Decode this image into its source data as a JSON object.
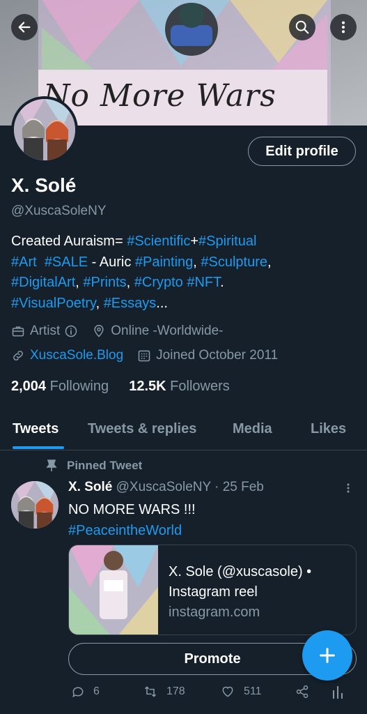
{
  "header": {
    "back_icon": "arrow-left-icon",
    "search_icon": "search-icon",
    "more_icon": "more-vertical-icon",
    "banner_text": "No More Wars"
  },
  "profile": {
    "edit_button": "Edit profile",
    "name": "X. Solé",
    "handle": "@XuscaSoleNY",
    "bio": {
      "p1": "Created Auraism= ",
      "t1": "#Scientific",
      "p2": "+",
      "t2": "#Spiritual",
      "t3": "#Art",
      "p3": "  ",
      "t4": "#SALE",
      "p4": " - Auric ",
      "t5": "#Painting",
      "p5": ", ",
      "t6": "#Sculpture",
      "p6": ",",
      "t7": "#DigitalArt",
      "p7": ", ",
      "t8": "#Prints",
      "p8": ", ",
      "t9": "#Crypto",
      "p9": " ",
      "t10": "#NFT",
      "p10": ".",
      "t11": "#VisualPoetry",
      "p11": ", ",
      "t12": "#Essays",
      "p12": "..."
    },
    "category": "Artist",
    "location": "Online -Worldwide-",
    "website": "XuscaSole.Blog",
    "joined": "Joined October 2011",
    "following_count": "2,004",
    "following_label": "Following",
    "followers_count": "12.5K",
    "followers_label": "Followers"
  },
  "tabs": [
    {
      "label": "Tweets"
    },
    {
      "label": "Tweets & replies"
    },
    {
      "label": "Media"
    },
    {
      "label": "Likes"
    }
  ],
  "tweet": {
    "pinned_label": "Pinned Tweet",
    "author_name": "X. Solé",
    "author_handle": "@XuscaSoleNY",
    "separator": " · ",
    "date": "25 Feb",
    "line1": "NO MORE WARS !!!",
    "line2": "#PeaceintheWorld",
    "card_title_1": "X. Sole (@xuscasole) •",
    "card_title_2": "Instagram reel",
    "card_domain": "instagram.com",
    "promote_label": "Promote",
    "replies": "6",
    "retweets": "178",
    "likes": "511"
  },
  "colors": {
    "background": "#15202b",
    "accent": "#1d9bf0",
    "secondary_text": "#8899a6",
    "border": "#38444d"
  }
}
